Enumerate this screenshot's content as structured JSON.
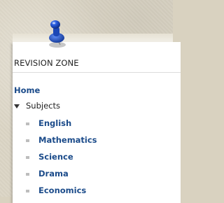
{
  "panel": {
    "title": "REVISION ZONE"
  },
  "menu": {
    "home": "Home",
    "subjects_label": "Subjects",
    "subjects": [
      {
        "label": "English"
      },
      {
        "label": "Mathematics"
      },
      {
        "label": "Science"
      },
      {
        "label": "Drama"
      },
      {
        "label": "Economics"
      }
    ]
  },
  "icons": {
    "pin": "push-pin-icon",
    "expander": "triangle-down-icon",
    "bullet": "square-bullet-icon"
  },
  "colors": {
    "link": "#1b4b8a",
    "pin": "#1f4fb8",
    "background": "#dcd6c6"
  }
}
